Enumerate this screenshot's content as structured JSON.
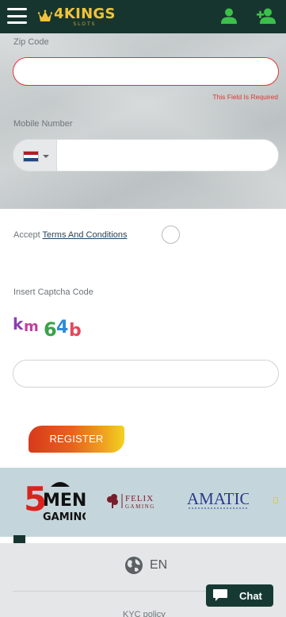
{
  "header": {
    "logo_main": "4KINGS",
    "logo_sub": "SLOTS",
    "menu_icon": "hamburger-menu-icon",
    "login_icon": "user-icon",
    "register_icon": "user-plus-icon",
    "background_color": "#17352f",
    "accent_color": "#3cc04a"
  },
  "form": {
    "zip_label": "Zip Code",
    "zip_value": "",
    "zip_error": "This Field Is Required",
    "mobile_label": "Mobile Number",
    "mobile_value": "",
    "country_flag": "netherlands-flag-icon",
    "accept_prefix": "Accept",
    "terms_link": "Terms And Conditions",
    "captcha_label": "Insert Captcha Code",
    "captcha_text": "km64b",
    "captcha_value": "",
    "register_label": "REGISTER",
    "error_color": "#e23434"
  },
  "providers": {
    "items": [
      "5MEN GAMING",
      "FELIX GAMING",
      "AMATIC"
    ]
  },
  "footer": {
    "language": "EN",
    "language_icon": "globe-icon",
    "kyc_link": "KYC policy",
    "chat_label": "Chat",
    "chat_icon": "chat-bubble-icon"
  }
}
